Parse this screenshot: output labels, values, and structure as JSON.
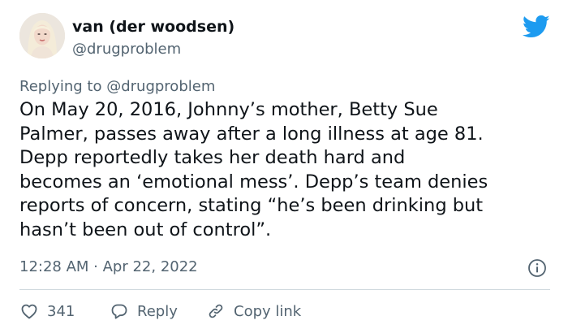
{
  "user": {
    "display_name": "van (der woodsen)",
    "handle": "@drugproblem",
    "avatar_icon": "profile-photo"
  },
  "brand": {
    "logo_icon": "twitter-bird-icon",
    "accent_color": "#1d9bf0"
  },
  "reply_context": {
    "prefix": "Replying to",
    "mention": "@drugproblem"
  },
  "tweet": {
    "lines": [
      "On May 20, 2016, Johnny’s mother, Betty Sue",
      "Palmer, passes away after a long illness at age 81.",
      "Depp reportedly takes her death hard and",
      "becomes an ‘emotional mess’. Depp’s team denies",
      "reports of concern, stating “he’s been drinking but",
      "hasn’t been out of control”."
    ],
    "timestamp": "12:28 AM · Apr 22, 2022"
  },
  "actions": {
    "like_count": "341",
    "reply_label": "Reply",
    "copy_link_label": "Copy link"
  },
  "colors": {
    "text_primary": "#0f1419",
    "text_secondary": "#536471",
    "divider": "#cfd9de"
  }
}
